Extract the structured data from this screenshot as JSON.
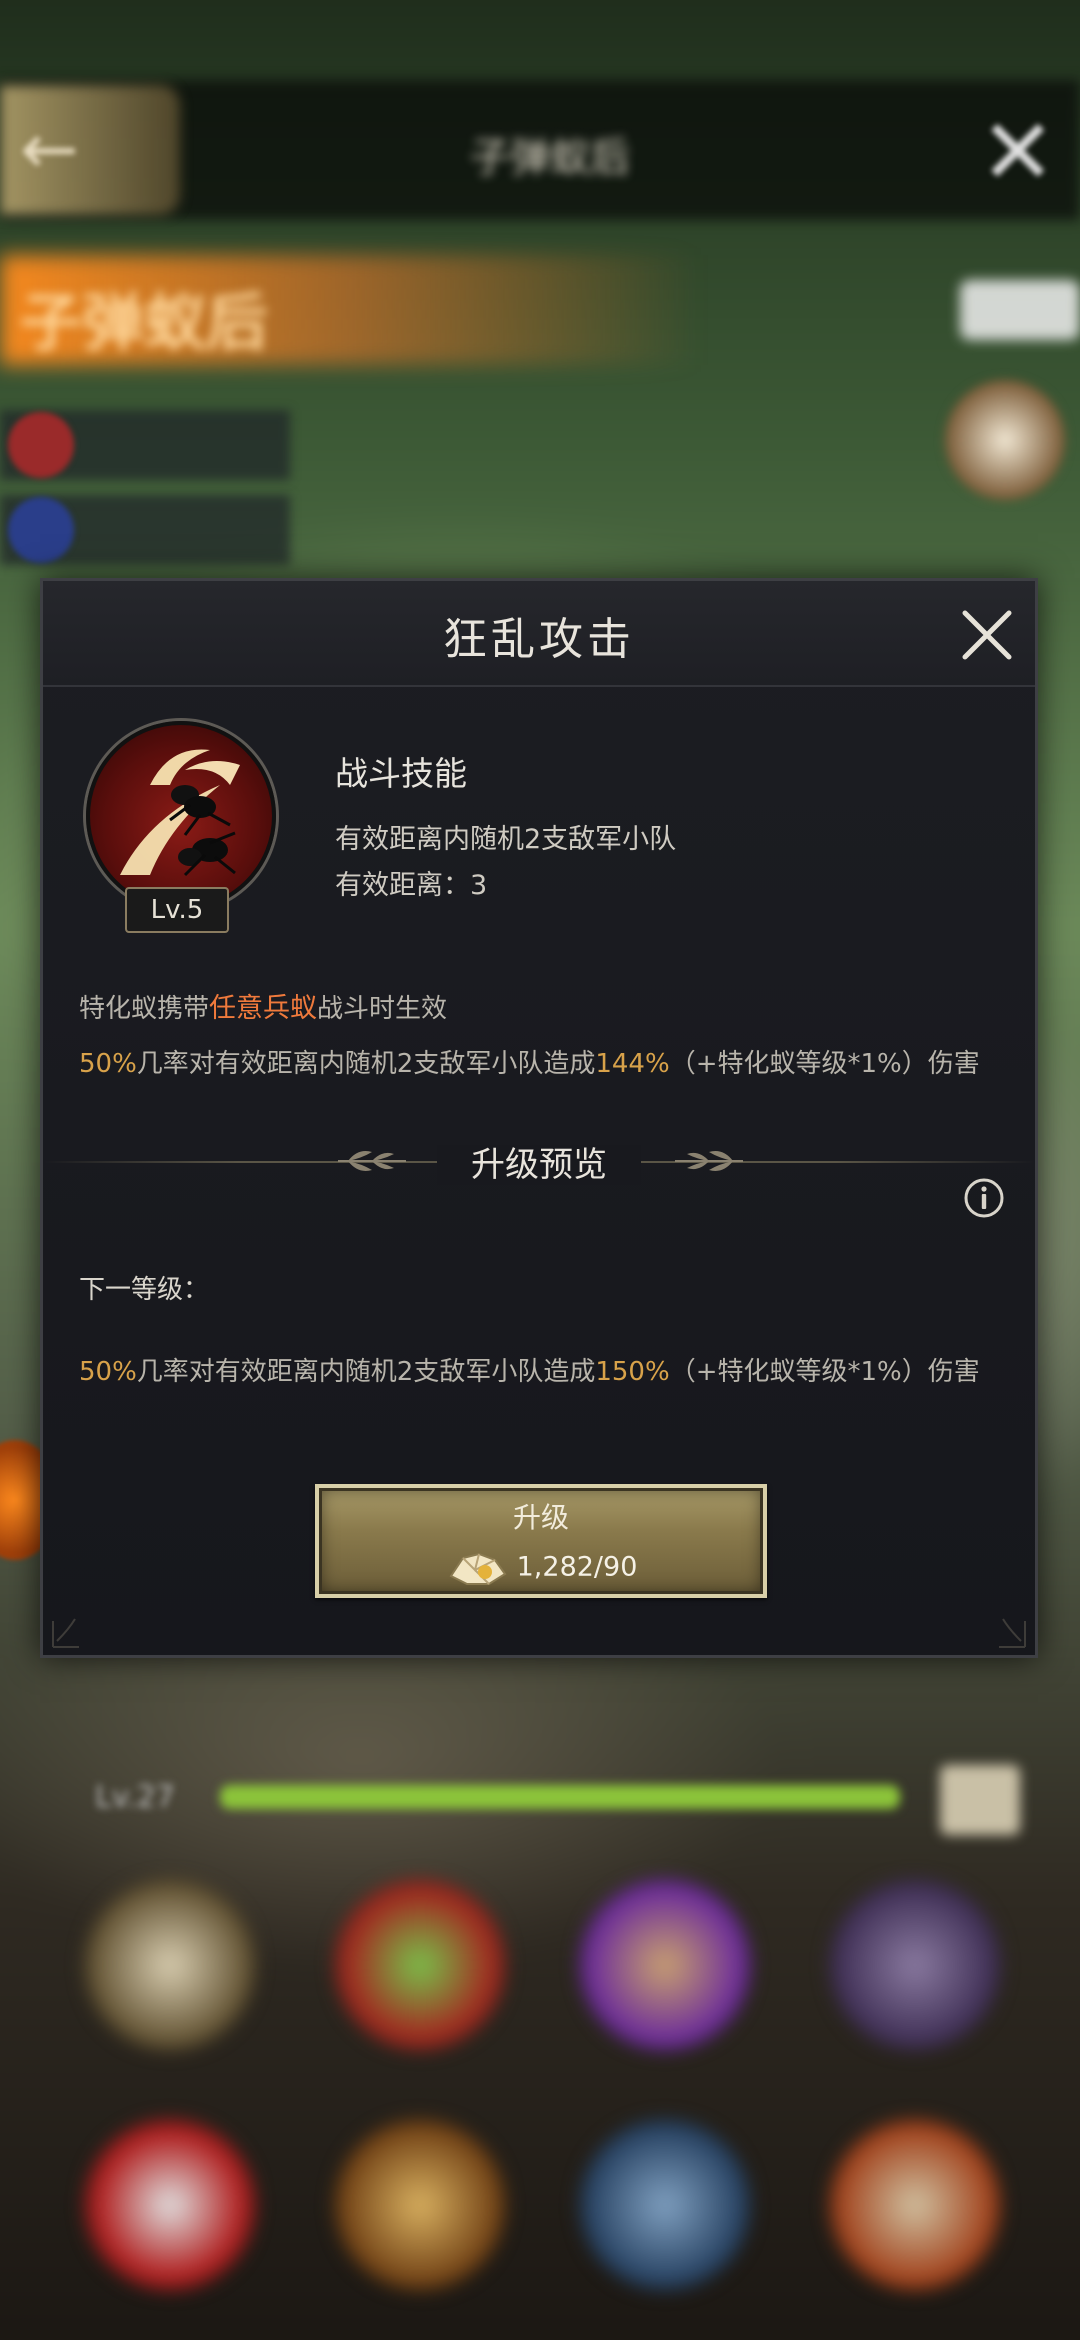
{
  "background": {
    "header_title": "子弹蚁后",
    "banner_text": "子弹蚁后",
    "xp_label": "Lv.27"
  },
  "dialog": {
    "title": "狂乱攻击",
    "skill_level": "Lv.5",
    "skill_type": "战斗技能",
    "description_line1": "有效距离内随机2支敌军小队",
    "description_line2": "有效距离：3",
    "condition": {
      "prefix": "特化蚁携带",
      "highlight": "任意兵蚁",
      "suffix": "战斗时生效"
    },
    "current_effect": {
      "chance": "50%",
      "text1": "几率对有效距离内随机2支敌军小队造成",
      "damage": "144%",
      "text2": "（+特化蚁等级*1%）伤害"
    },
    "section_title": "升级预览",
    "next_level_label": "下一等级：",
    "next_effect": {
      "chance": "50%",
      "text1": "几率对有效距离内随机2支敌军小队造成",
      "damage": "150%",
      "text2": "（+特化蚁等级*1%）伤害"
    },
    "upgrade_button": {
      "label": "升级",
      "cost": "1,282/90"
    }
  },
  "colors": {
    "highlight_orange": "#f07a3c",
    "gold_value": "#d8a24a",
    "dialog_bg": "#18191e"
  }
}
